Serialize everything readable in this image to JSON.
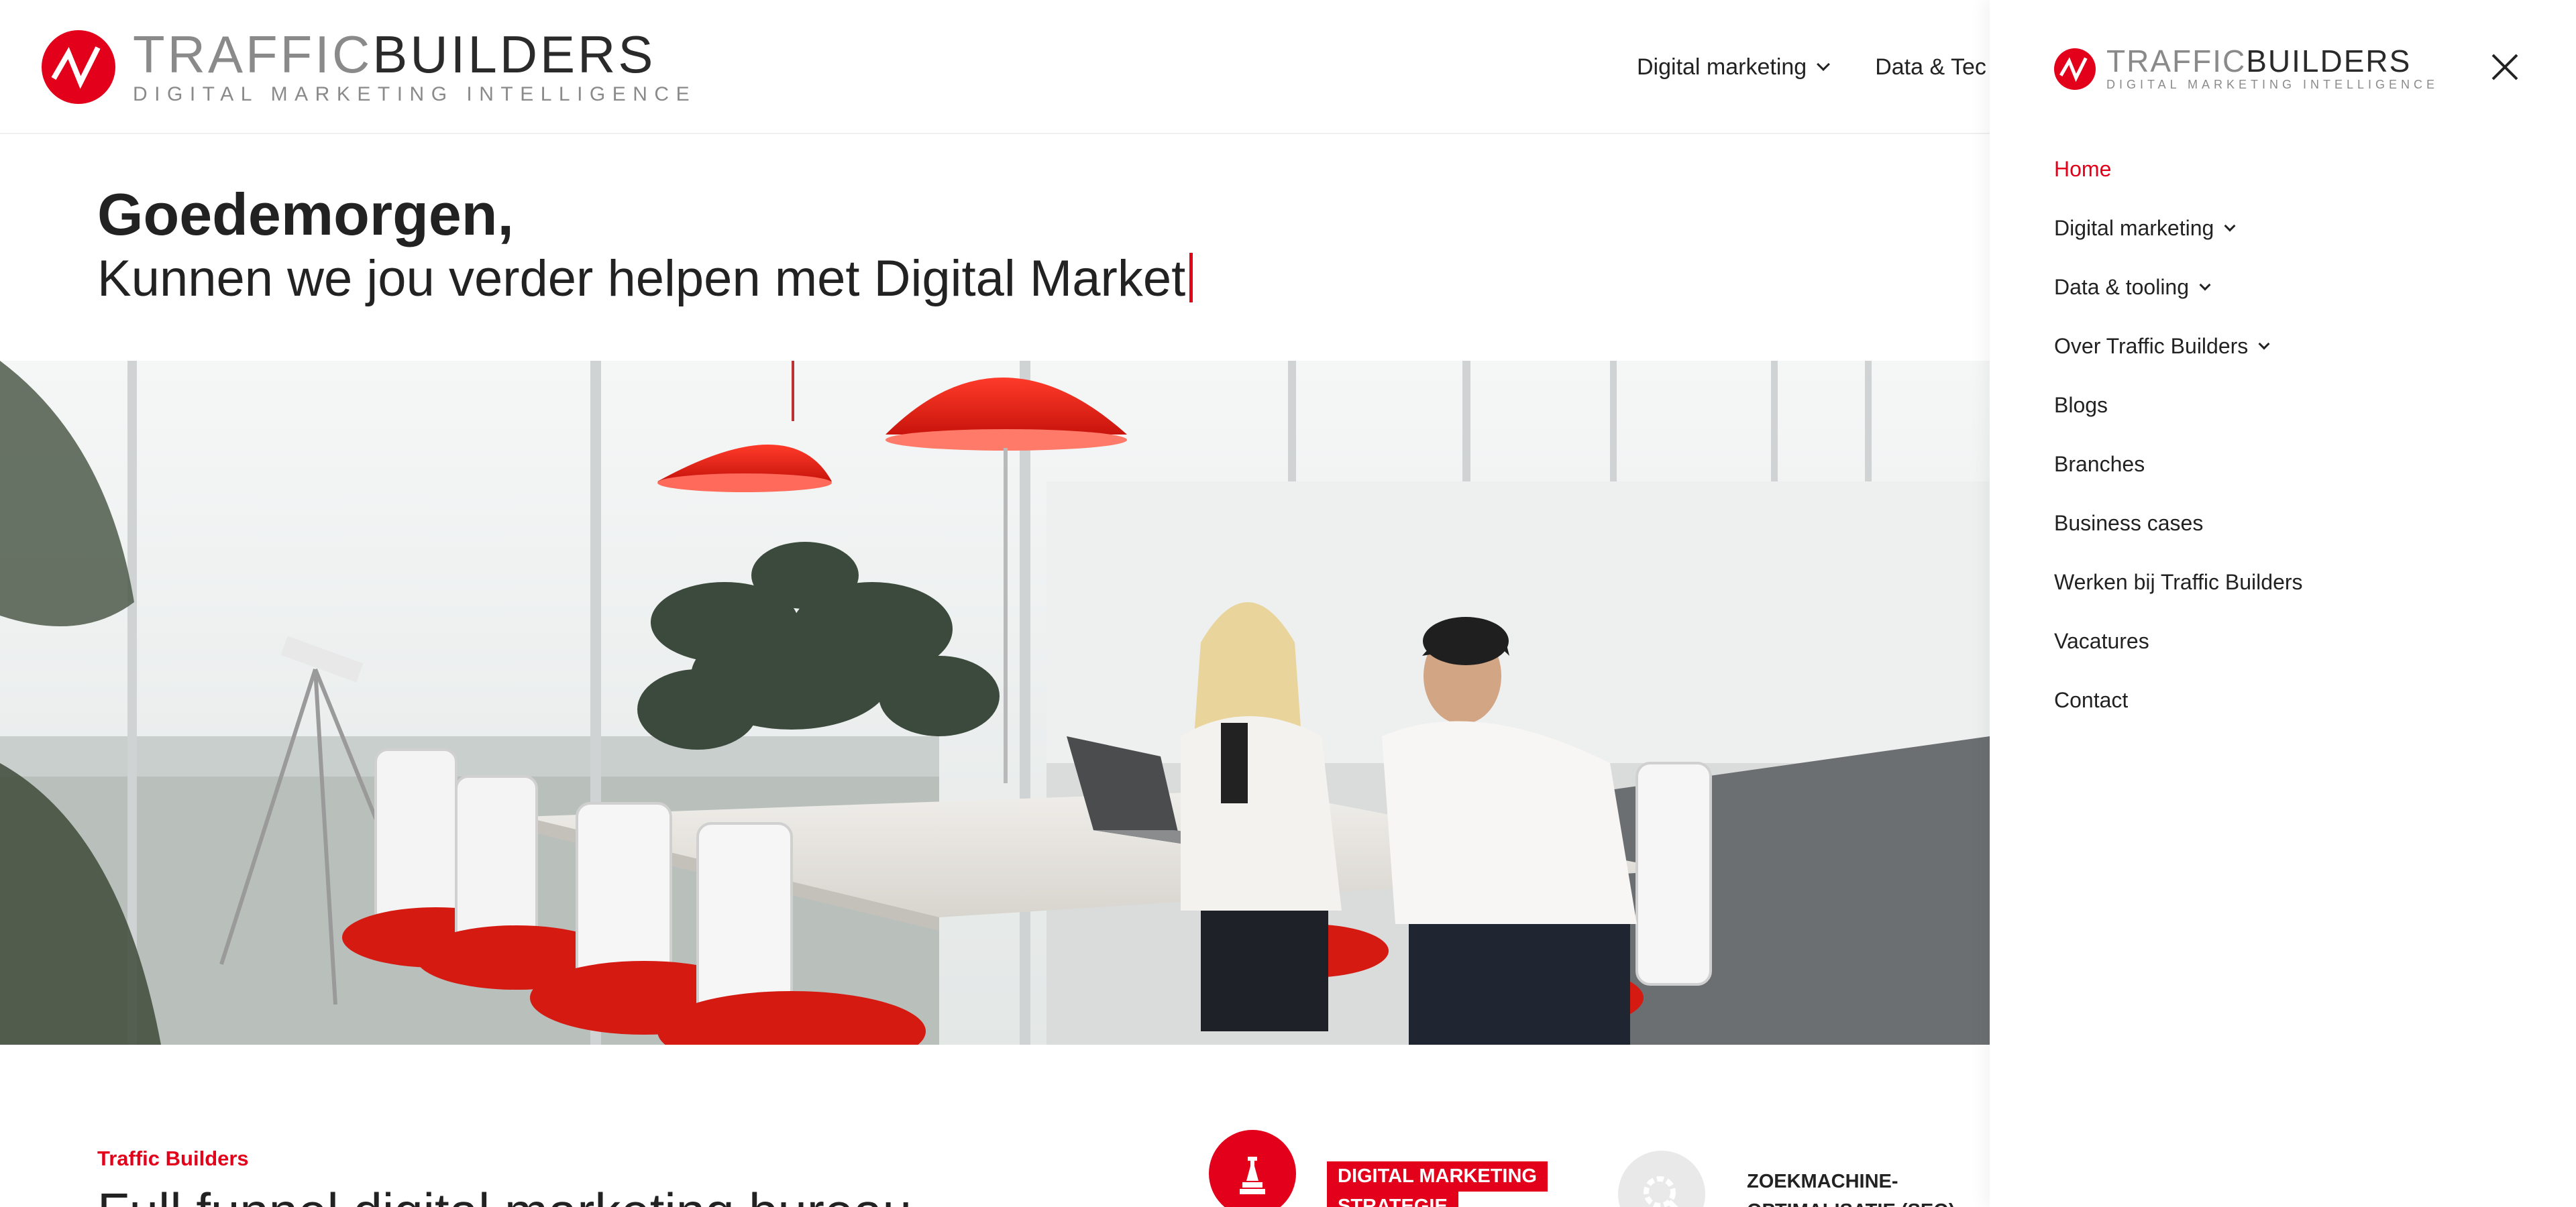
{
  "brand": {
    "name_light": "TRAFFIC",
    "name_bold": "BUILDERS",
    "tagline": "DIGITAL MARKETING INTELLIGENCE",
    "accent_color": "#e2001a"
  },
  "header": {
    "nav": [
      {
        "label": "Digital marketing",
        "icon": "chevron-down-icon"
      },
      {
        "label": "Data & Tec",
        "icon": ""
      }
    ]
  },
  "greeting": {
    "title": "Goedemorgen,",
    "subtitle": "Kunnen we jou verder helpen met Digital Market"
  },
  "hero": {
    "alt": "hero-photo"
  },
  "intro": {
    "label": "Traffic Builders",
    "title": "Full funnel digital marketing bureau"
  },
  "services": [
    {
      "label_line1": "DIGITAL MARKETING",
      "label_line2": "STRATEGIE",
      "icon": "chess-piece-icon"
    },
    {
      "label_line1": "ZOEKMACHINE-",
      "label_line2": "OPTIMALISATIE (SEO)",
      "icon": "gear-icon"
    }
  ],
  "side_menu": {
    "close_icon": "close-icon",
    "items": [
      {
        "label": "Home",
        "active": true,
        "has_submenu": false
      },
      {
        "label": "Digital marketing",
        "active": false,
        "has_submenu": true
      },
      {
        "label": "Data & tooling",
        "active": false,
        "has_submenu": true
      },
      {
        "label": "Over Traffic Builders",
        "active": false,
        "has_submenu": true
      },
      {
        "label": "Blogs",
        "active": false,
        "has_submenu": false
      },
      {
        "label": "Branches",
        "active": false,
        "has_submenu": false
      },
      {
        "label": "Business cases",
        "active": false,
        "has_submenu": false
      },
      {
        "label": "Werken bij Traffic Builders",
        "active": false,
        "has_submenu": false
      },
      {
        "label": "Vacatures",
        "active": false,
        "has_submenu": false
      },
      {
        "label": "Contact",
        "active": false,
        "has_submenu": false
      }
    ]
  }
}
